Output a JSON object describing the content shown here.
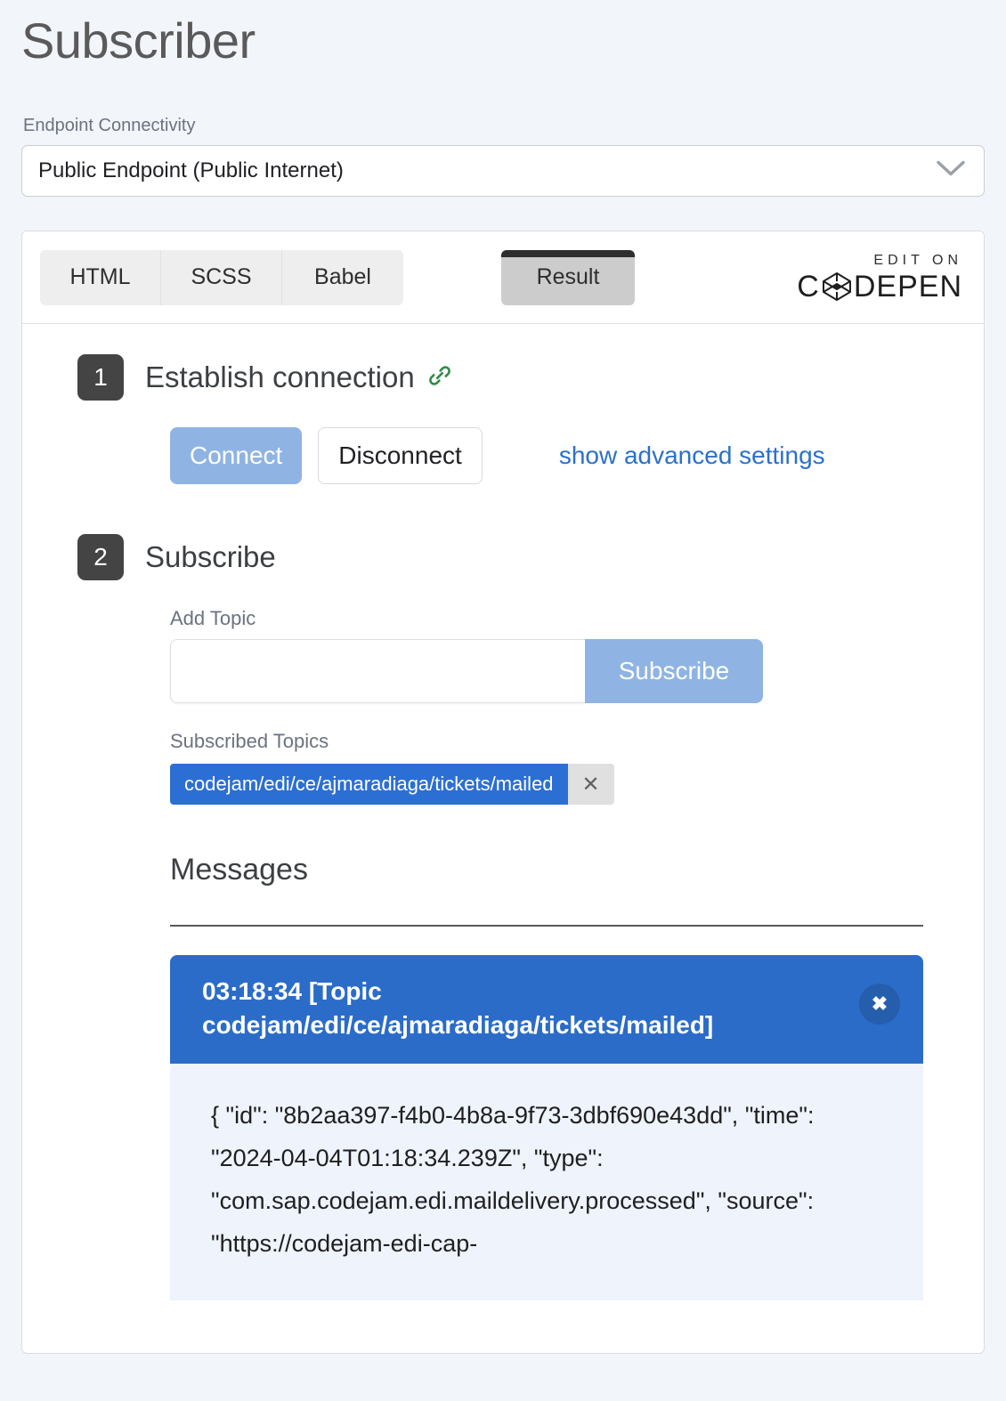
{
  "page": {
    "title": "Subscriber"
  },
  "endpoint": {
    "label": "Endpoint Connectivity",
    "selected": "Public Endpoint  (Public Internet)",
    "chevron_icon": "chevron-down-icon"
  },
  "embed": {
    "tabs": [
      {
        "label": "HTML"
      },
      {
        "label": "SCSS"
      },
      {
        "label": "Babel"
      }
    ],
    "result_tab": "Result",
    "codepen": {
      "edit_on": "EDIT ON",
      "word_prefix": "C",
      "word_suffix": "DEPEN",
      "mark_icon": "codepen-logo-icon"
    }
  },
  "step1": {
    "number": "1",
    "title": "Establish connection",
    "icon": "link-icon",
    "connect_label": "Connect",
    "disconnect_label": "Disconnect",
    "advanced_link": "show advanced settings"
  },
  "step2": {
    "number": "2",
    "title": "Subscribe",
    "add_topic_label": "Add Topic",
    "topic_input_value": "",
    "topic_input_placeholder": "",
    "subscribe_label": "Subscribe",
    "subscribed_topics_label": "Subscribed Topics",
    "topics": [
      {
        "name": "codejam/edi/ce/ajmaradiaga/tickets/mailed",
        "remove_label": "✕"
      }
    ]
  },
  "messages": {
    "heading": "Messages",
    "items": [
      {
        "header": "03:18:34 [Topic codejam/edi/ce/ajmaradiaga/tickets/mailed]",
        "close_label": "✖",
        "body": "{ \"id\": \"8b2aa397-f4b0-4b8a-9f73-3dbf690e43dd\", \"time\": \"2024-04-04T01:18:34.239Z\", \"type\": \"com.sap.codejam.edi.maildelivery.processed\", \"source\": \"https://codejam-edi-cap-"
      }
    ]
  },
  "colors": {
    "page_background": "#f2f5fa",
    "accent_blue": "#2b6cc9",
    "muted_blue": "#8fb4e3",
    "link_blue": "#2b70cc",
    "badge_dark": "#444444",
    "link_icon_green": "#2e8b47"
  }
}
